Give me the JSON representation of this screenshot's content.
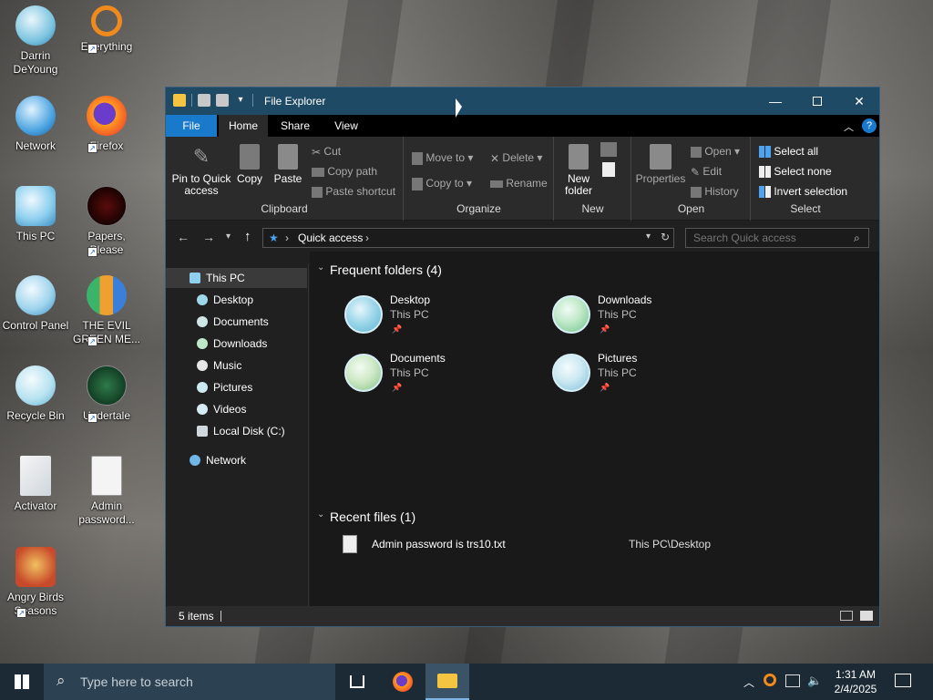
{
  "desktop": {
    "icons": [
      {
        "label": "Darrin DeYoung"
      },
      {
        "label": "Everything"
      },
      {
        "label": "Network"
      },
      {
        "label": "Firefox"
      },
      {
        "label": "This PC"
      },
      {
        "label": "Papers, Please"
      },
      {
        "label": "Control Panel"
      },
      {
        "label": "THE EVIL GREEN ME..."
      },
      {
        "label": "Recycle Bin"
      },
      {
        "label": "Undertale"
      },
      {
        "label": "Activator"
      },
      {
        "label": "Admin password..."
      },
      {
        "label": "Angry Birds Seasons"
      }
    ]
  },
  "window": {
    "title": "File Explorer",
    "tabs": {
      "file": "File",
      "home": "Home",
      "share": "Share",
      "view": "View"
    },
    "ribbon": {
      "clipboard": {
        "pin": "Pin to Quick access",
        "copy": "Copy",
        "paste": "Paste",
        "cut": "Cut",
        "copy_path": "Copy path",
        "paste_shortcut": "Paste shortcut",
        "name": "Clipboard"
      },
      "organize": {
        "move_to": "Move to",
        "copy_to": "Copy to",
        "delete": "Delete",
        "rename": "Rename",
        "name": "Organize"
      },
      "new": {
        "new_folder": "New folder",
        "name": "New"
      },
      "open": {
        "properties": "Properties",
        "open": "Open",
        "edit": "Edit",
        "history": "History",
        "name": "Open"
      },
      "select": {
        "select_all": "Select all",
        "select_none": "Select none",
        "invert": "Invert selection",
        "name": "Select"
      }
    },
    "address": {
      "location": "Quick access"
    },
    "search": {
      "placeholder": "Search Quick access"
    },
    "sidebar": {
      "items": [
        {
          "label": "This PC"
        },
        {
          "label": "Desktop"
        },
        {
          "label": "Documents"
        },
        {
          "label": "Downloads"
        },
        {
          "label": "Music"
        },
        {
          "label": "Pictures"
        },
        {
          "label": "Videos"
        },
        {
          "label": "Local Disk (C:)"
        },
        {
          "label": "Network"
        }
      ]
    },
    "content": {
      "frequent_header": "Frequent folders (4)",
      "folders": [
        {
          "name": "Desktop",
          "location": "This PC"
        },
        {
          "name": "Downloads",
          "location": "This PC"
        },
        {
          "name": "Documents",
          "location": "This PC"
        },
        {
          "name": "Pictures",
          "location": "This PC"
        }
      ],
      "recent_header": "Recent files (1)",
      "recent_files": [
        {
          "name": "Admin password is trs10.txt",
          "path": "This PC\\Desktop"
        }
      ]
    },
    "status": {
      "items": "5 items"
    }
  },
  "taskbar": {
    "search_placeholder": "Type here to search",
    "time": "1:31 AM",
    "date": "2/4/2025"
  },
  "colors": {
    "accent": "#1979ca",
    "titlebar": "#1e4a66",
    "window_bg": "#202020",
    "taskbar": "#1b2a35"
  }
}
